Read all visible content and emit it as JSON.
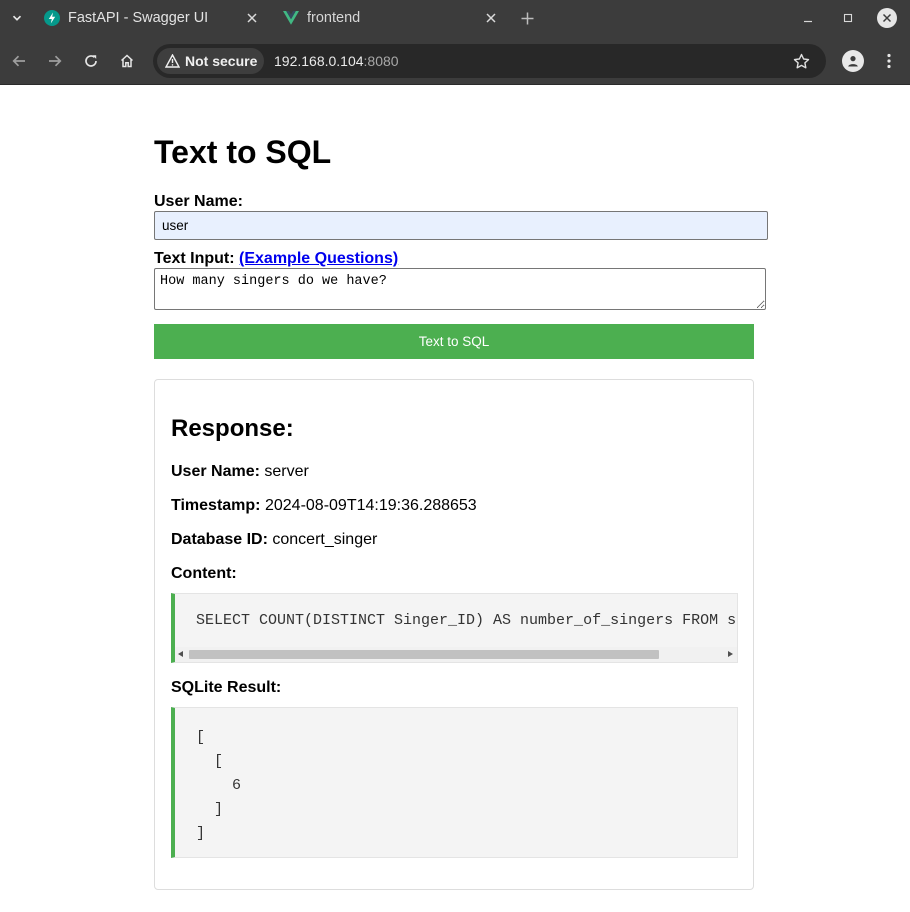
{
  "browser": {
    "tabs": [
      {
        "title": "FastAPI - Swagger UI",
        "icon": "fastapi-icon"
      },
      {
        "title": "frontend",
        "icon": "vue-icon"
      }
    ],
    "security_label": "Not secure",
    "url_host": "192.168.0.104",
    "url_port": ":8080"
  },
  "page": {
    "title": "Text to SQL",
    "user_name_label": "User Name:",
    "user_name_value": "user",
    "text_input_label": "Text Input:",
    "example_link": "(Example Questions)",
    "text_input_value": "How many singers do we have?",
    "submit_label": "Text to SQL"
  },
  "response": {
    "title": "Response:",
    "user_name_label": "User Name:",
    "user_name": "server",
    "timestamp_label": "Timestamp:",
    "timestamp": "2024-08-09T14:19:36.288653",
    "database_label": "Database ID:",
    "database_id": "concert_singer",
    "content_label": "Content:",
    "content": "SELECT COUNT(DISTINCT Singer_ID) AS number_of_singers FROM singer;",
    "sqlite_label": "SQLite Result:",
    "sqlite_result": "[\n  [\n    6\n  ]\n]"
  },
  "colors": {
    "accent_green": "#4caf50",
    "link_blue": "#0000ee",
    "chrome_dark": "#3c3c3c"
  }
}
